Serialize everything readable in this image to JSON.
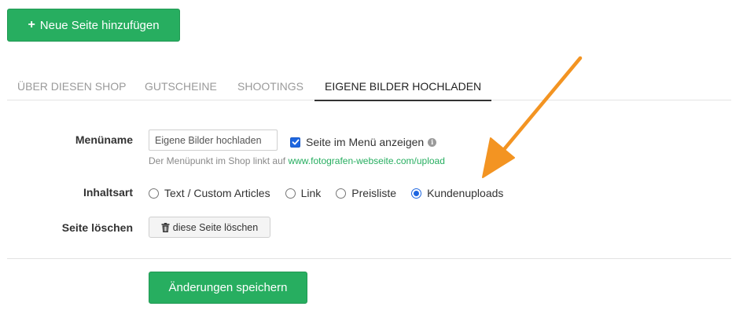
{
  "toolbar": {
    "add_page_label": "Neue Seite hinzufügen",
    "add_icon": "plus-icon"
  },
  "tabs": [
    {
      "label": "ÜBER DIESEN SHOP",
      "active": false
    },
    {
      "label": "GUTSCHEINE",
      "active": false
    },
    {
      "label": "SHOOTINGS",
      "active": false
    },
    {
      "label": "EIGENE BILDER HOCHLADEN",
      "active": true
    }
  ],
  "form": {
    "menu_name_label": "Menüname",
    "menu_name_value": "Eigene Bilder hochladen",
    "show_in_menu_label": "Seite im Menü anzeigen",
    "show_in_menu_checked": true,
    "help_text_prefix": "Der Menüpunkt im Shop linkt auf",
    "help_link": "www.fotografen-webseite.com/upload",
    "content_type_label": "Inhaltsart",
    "content_types": [
      {
        "label": "Text / Custom Articles",
        "checked": false
      },
      {
        "label": "Link",
        "checked": false
      },
      {
        "label": "Preisliste",
        "checked": false
      },
      {
        "label": "Kundenuploads",
        "checked": true
      }
    ],
    "delete_label": "Seite löschen",
    "delete_button_label": "diese Seite löschen",
    "delete_icon": "trash-icon"
  },
  "actions": {
    "save_label": "Änderungen speichern"
  },
  "colors": {
    "primary_green": "#27ae60",
    "annotation_orange": "#f39422",
    "checkbox_blue": "#1e66e0"
  }
}
